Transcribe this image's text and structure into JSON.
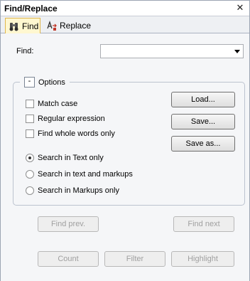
{
  "window": {
    "title": "Find/Replace",
    "close_glyph": "✕"
  },
  "tabs": [
    {
      "label": "Find",
      "icon": "binoculars-icon",
      "active": true
    },
    {
      "label": "Replace",
      "icon": "replace-icon",
      "active": false
    }
  ],
  "find": {
    "label": "Find:",
    "value": ""
  },
  "options": {
    "label": "Options",
    "toggle_glyph": "-",
    "checkboxes": [
      {
        "label": "Match case",
        "checked": false
      },
      {
        "label": "Regular expression",
        "checked": false
      },
      {
        "label": "Find whole words only",
        "checked": false
      }
    ],
    "radios": [
      {
        "label": "Search in Text only",
        "checked": true
      },
      {
        "label": "Search in text and markups",
        "checked": false
      },
      {
        "label": "Search in Markups only",
        "checked": false
      }
    ],
    "load_label": "Load...",
    "save_label": "Save...",
    "save_as_label": "Save as..."
  },
  "actions": {
    "find_prev": "Find prev.",
    "find_next": "Find next",
    "count": "Count",
    "filter": "Filter",
    "highlight": "Highlight"
  },
  "colors": {
    "active_tab": "#fff7d0",
    "active_tab_border": "#e0b64c"
  }
}
